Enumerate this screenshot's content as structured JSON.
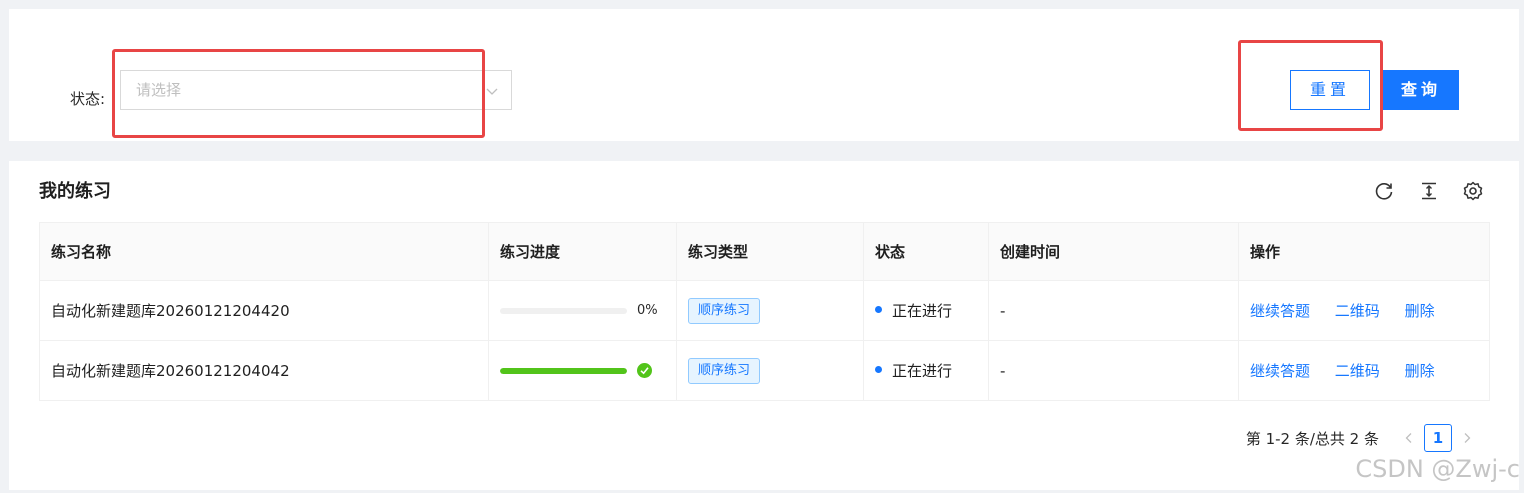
{
  "filter": {
    "status_label": "状态:",
    "status_placeholder": "请选择",
    "reset_label": "重置",
    "query_label": "查询"
  },
  "card": {
    "title": "我的练习",
    "toolbar_icons": [
      "refresh-icon",
      "density-icon",
      "setting-icon"
    ]
  },
  "table": {
    "columns": [
      "练习名称",
      "练习进度",
      "练习类型",
      "状态",
      "创建时间",
      "操作"
    ],
    "rows": [
      {
        "name": "自动化新建题库20260121204420",
        "progress": 0,
        "progress_text": "0%",
        "type": "顺序练习",
        "status": "正在进行",
        "created": "-",
        "actions": [
          "继续答题",
          "二维码",
          "删除"
        ]
      },
      {
        "name": "自动化新建题库20260121204042",
        "progress": 100,
        "progress_text": "",
        "type": "顺序练习",
        "status": "正在进行",
        "created": "-",
        "actions": [
          "继续答题",
          "二维码",
          "删除"
        ]
      }
    ]
  },
  "pagination": {
    "total_text": "第 1-2 条/总共 2 条",
    "current_page": "1"
  },
  "watermark": "CSDN @Zwj-c",
  "colors": {
    "primary": "#1677ff",
    "success": "#52c41a",
    "annotation": "#e84545"
  }
}
